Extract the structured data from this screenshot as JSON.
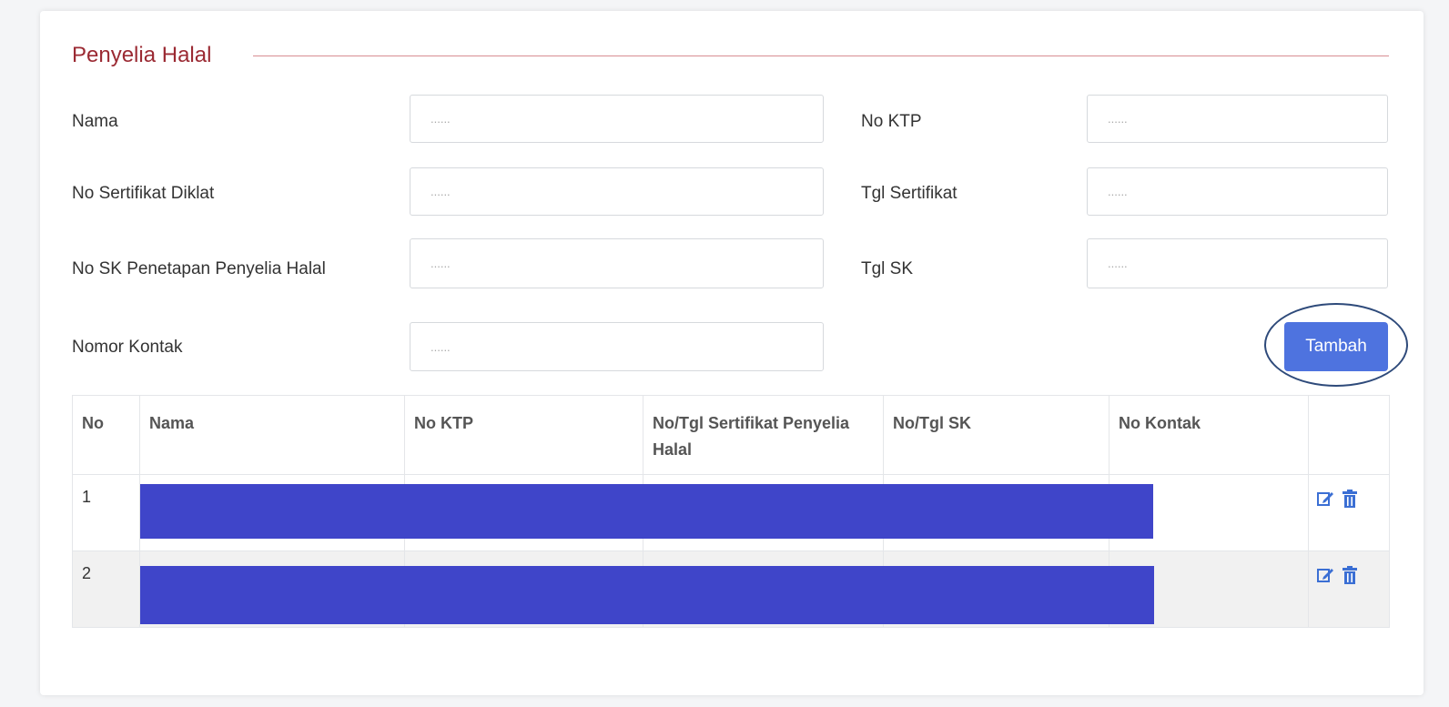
{
  "section": {
    "title": "Penyelia Halal"
  },
  "form": {
    "nama": {
      "label": "Nama",
      "placeholder": "......"
    },
    "no_ktp": {
      "label": "No KTP",
      "placeholder": "......"
    },
    "no_sertifikat": {
      "label": "No Sertifikat Diklat",
      "placeholder": "......"
    },
    "tgl_sertifikat": {
      "label": "Tgl Sertifikat",
      "placeholder": "......"
    },
    "no_sk": {
      "label": "No SK Penetapan Penyelia Halal",
      "placeholder": "......"
    },
    "tgl_sk": {
      "label": "Tgl SK",
      "placeholder": "......"
    },
    "nomor_kontak": {
      "label": "Nomor Kontak",
      "placeholder": "......"
    },
    "add_button": "Tambah"
  },
  "table": {
    "headers": [
      "No",
      "Nama",
      "No KTP",
      "No/Tgl Sertifikat Penyelia Halal",
      "No/Tgl SK",
      "No Kontak",
      ""
    ],
    "rows": [
      {
        "no": "1"
      },
      {
        "no": "2"
      }
    ]
  },
  "colors": {
    "accent": "#9b2a33",
    "button": "#4e73df",
    "redaction": "#3f45c9",
    "icon": "#3b6fd4"
  },
  "icons": {
    "edit": "edit-icon",
    "delete": "trash-icon"
  }
}
